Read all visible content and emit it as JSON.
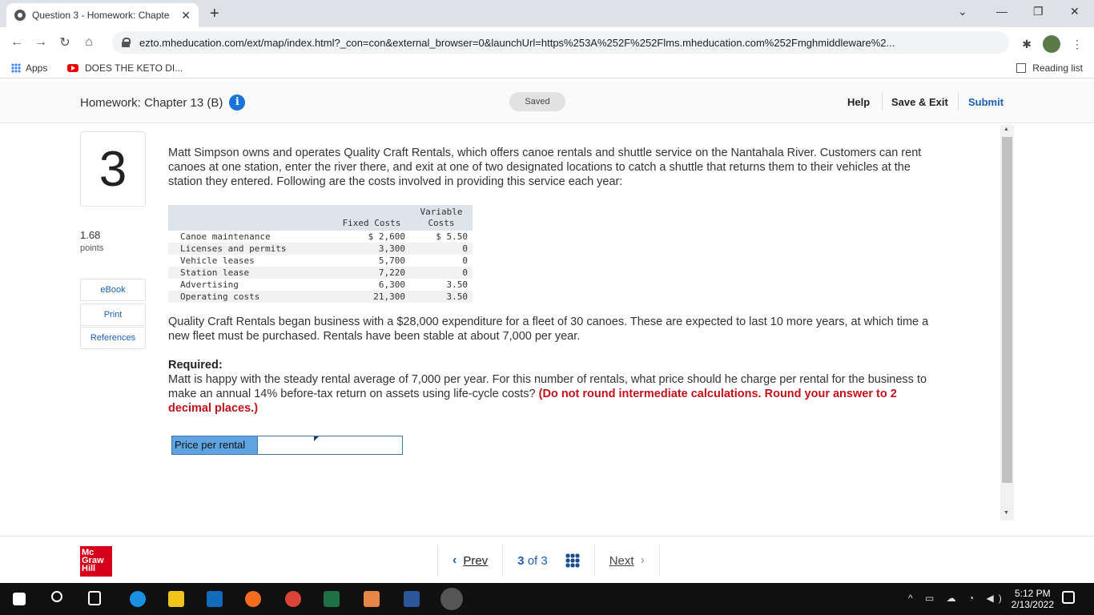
{
  "browser": {
    "tab_title": "Question 3 - Homework: Chapte",
    "tab_close": "✕",
    "new_tab": "+",
    "url": "ezto.mheducation.com/ext/map/index.html?_con=con&external_browser=0&launchUrl=https%253A%252F%252Flms.mheducation.com%252Fmghmiddleware%2...",
    "bookmarks": {
      "apps": "Apps",
      "keto": "DOES THE KETO DI...",
      "reading_list": "Reading list"
    }
  },
  "header": {
    "title": "Homework: Chapter 13 (B)",
    "info_glyph": "i",
    "saved": "Saved",
    "help": "Help",
    "save_exit": "Save & Exit",
    "submit": "Submit"
  },
  "question": {
    "number": "3",
    "points_value": "1.68",
    "points_label": "points",
    "ebook": "eBook",
    "print": "Print",
    "references": "References",
    "intro": "Matt Simpson owns and operates Quality Craft Rentals, which offers canoe rentals and shuttle service on the Nantahala River. Customers can rent canoes at one station, enter the river there, and exit at one of two designated locations to catch a shuttle that returns them to their vehicles at the station they entered. Following are the costs involved in providing this service each year:",
    "table": {
      "col_fixed": "Fixed Costs",
      "col_variable_1": "Variable",
      "col_variable_2": "Costs",
      "rows": [
        {
          "label": "Canoe maintenance",
          "fixed": "$ 2,600",
          "variable": "$ 5.50"
        },
        {
          "label": "Licenses and permits",
          "fixed": "3,300",
          "variable": "0"
        },
        {
          "label": "Vehicle leases",
          "fixed": "5,700",
          "variable": "0"
        },
        {
          "label": "Station lease",
          "fixed": "7,220",
          "variable": "0"
        },
        {
          "label": "Advertising",
          "fixed": "6,300",
          "variable": "3.50"
        },
        {
          "label": "Operating costs",
          "fixed": "21,300",
          "variable": "3.50"
        }
      ]
    },
    "para2": "Quality Craft Rentals began business with a $28,000 expenditure for a fleet of 30 canoes. These are expected to last 10 more years, at which time a new fleet must be purchased. Rentals have been stable at about 7,000 per year.",
    "required_heading": "Required:",
    "required_text": "Matt is happy with the steady rental average of 7,000 per year. For this number of rentals, what price should he charge per rental for the business to make an annual 14% before-tax return on assets using life-cycle costs?",
    "required_note": "(Do not round intermediate calculations. Round your answer to 2 decimal places.)",
    "answer_label": "Price per rental",
    "answer_value": ""
  },
  "footer": {
    "logo_line1": "Mc",
    "logo_line2": "Graw",
    "logo_line3": "Hill",
    "prev": "Prev",
    "page_current": "3",
    "page_of": "of",
    "page_total": "3",
    "next": "Next"
  },
  "taskbar": {
    "time": "5:12 PM",
    "date": "2/13/2022"
  },
  "colors": {
    "accent": "#1a73d9",
    "required_note": "#c0121b",
    "answer_label_bg": "#5fa4e0",
    "brand": "#d6001c"
  }
}
